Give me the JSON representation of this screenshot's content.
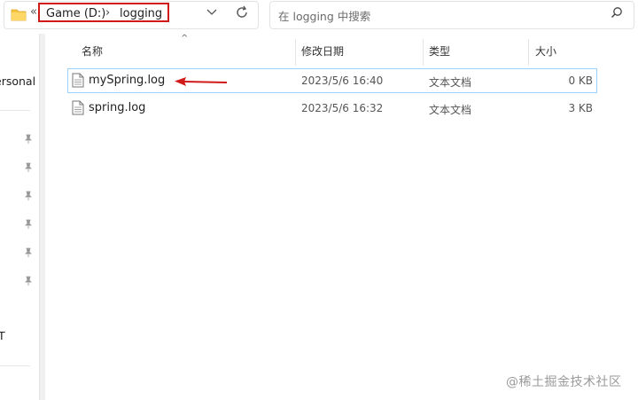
{
  "address": {
    "segments": [
      "Game (D:)",
      "logging"
    ],
    "separator": "›",
    "back_glyph": "«"
  },
  "search": {
    "placeholder": "在 logging 中搜索"
  },
  "nav": {
    "items": [
      "ersonal",
      "T"
    ]
  },
  "columns": {
    "name": "名称",
    "modified": "修改日期",
    "type": "类型",
    "size": "大小"
  },
  "files": [
    {
      "name": "mySpring.log",
      "modified": "2023/5/6 16:40",
      "type": "文本文档",
      "size": "0 KB"
    },
    {
      "name": "spring.log",
      "modified": "2023/5/6 16:32",
      "type": "文本文档",
      "size": "3 KB"
    }
  ],
  "watermark": "@稀土掘金技术社区",
  "colors": {
    "highlight_red": "#d11a1a",
    "selection_border": "#99d1ff",
    "folder_yellow": "#f5c542"
  }
}
